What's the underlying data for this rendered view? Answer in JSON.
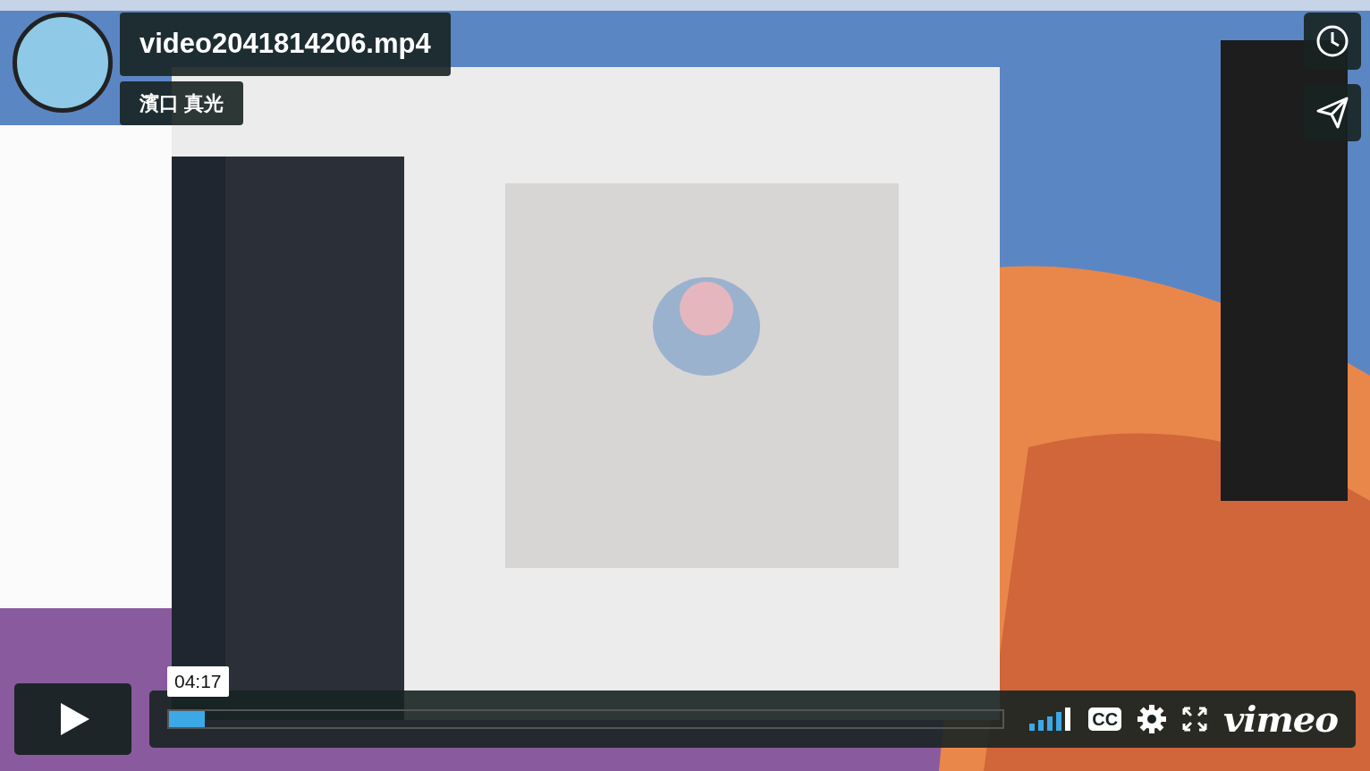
{
  "video": {
    "kind": "picture",
    "title": "video2041814206.mp4",
    "byline": "濱口 真光"
  },
  "controls": {
    "time": "04:17",
    "progress": {
      "level": 0.043
    },
    "cc_label": "CC",
    "logo": "vimeo"
  }
}
